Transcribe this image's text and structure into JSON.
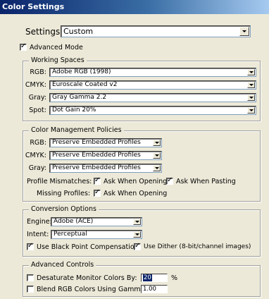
{
  "window": {
    "title": "Color Settings"
  },
  "settings": {
    "label": "Settings:",
    "value": "Custom"
  },
  "advanced_mode": {
    "label": "Advanced Mode",
    "checked": true
  },
  "working_spaces": {
    "title": "Working Spaces",
    "rgb": {
      "label": "RGB:",
      "value": "Adobe RGB (1998)"
    },
    "cmyk": {
      "label": "CMYK:",
      "value": "Euroscale Coated v2"
    },
    "gray": {
      "label": "Gray:",
      "value": "Gray Gamma 2.2"
    },
    "spot": {
      "label": "Spot:",
      "value": "Dot Gain 20%"
    }
  },
  "policies": {
    "title": "Color Management Policies",
    "rgb": {
      "label": "RGB:",
      "value": "Preserve Embedded Profiles"
    },
    "cmyk": {
      "label": "CMYK:",
      "value": "Preserve Embedded Profiles"
    },
    "gray": {
      "label": "Gray:",
      "value": "Preserve Embedded Profiles"
    },
    "profile_mismatches": {
      "label": "Profile Mismatches:",
      "ask_opening": {
        "label": "Ask When Opening",
        "checked": true
      },
      "ask_pasting": {
        "label": "Ask When Pasting",
        "checked": true
      }
    },
    "missing_profiles": {
      "label": "Missing Profiles:",
      "ask_opening": {
        "label": "Ask When Opening",
        "checked": true
      }
    }
  },
  "conversion": {
    "title": "Conversion Options",
    "engine": {
      "label": "Engine:",
      "value": "Adobe (ACE)"
    },
    "intent": {
      "label": "Intent:",
      "value": "Perceptual"
    },
    "black_point": {
      "label": "Use Black Point Compensation",
      "checked": true
    },
    "dither": {
      "label": "Use Dither (8-bit/channel images)",
      "checked": true
    }
  },
  "advanced_controls": {
    "title": "Advanced Controls",
    "desaturate": {
      "label": "Desaturate Monitor Colors By:",
      "checked": false,
      "value": "20",
      "unit": "%"
    },
    "blend": {
      "label": "Blend RGB Colors Using Gamma:",
      "checked": false,
      "value": "1.00"
    }
  },
  "colors": {
    "titlebar_start": "#0a246a",
    "titlebar_end": "#a6caf0",
    "dialog_bg": "#ece9d8"
  }
}
